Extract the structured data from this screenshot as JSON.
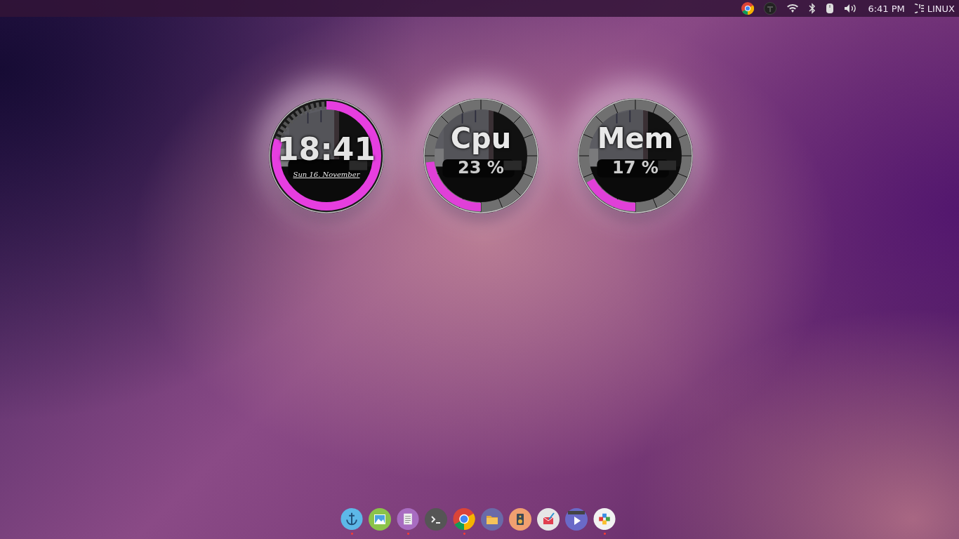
{
  "top_bar": {
    "clock": "6:41 PM",
    "session": "LINUX"
  },
  "clock_widget": {
    "time": "18:41",
    "date": "Sun 16. November",
    "level": 0.8
  },
  "gauges": [
    {
      "label": "Cpu",
      "reading": "23 %",
      "level": 0.23
    },
    {
      "label": "Mem",
      "reading": "17 %",
      "level": 0.17
    }
  ],
  "dock": [
    {
      "running": true
    },
    {
      "running": false
    },
    {
      "running": true
    },
    {
      "running": false
    },
    {
      "running": true
    },
    {
      "running": false
    },
    {
      "running": false
    },
    {
      "running": false
    },
    {
      "running": false
    },
    {
      "running": true
    }
  ]
}
